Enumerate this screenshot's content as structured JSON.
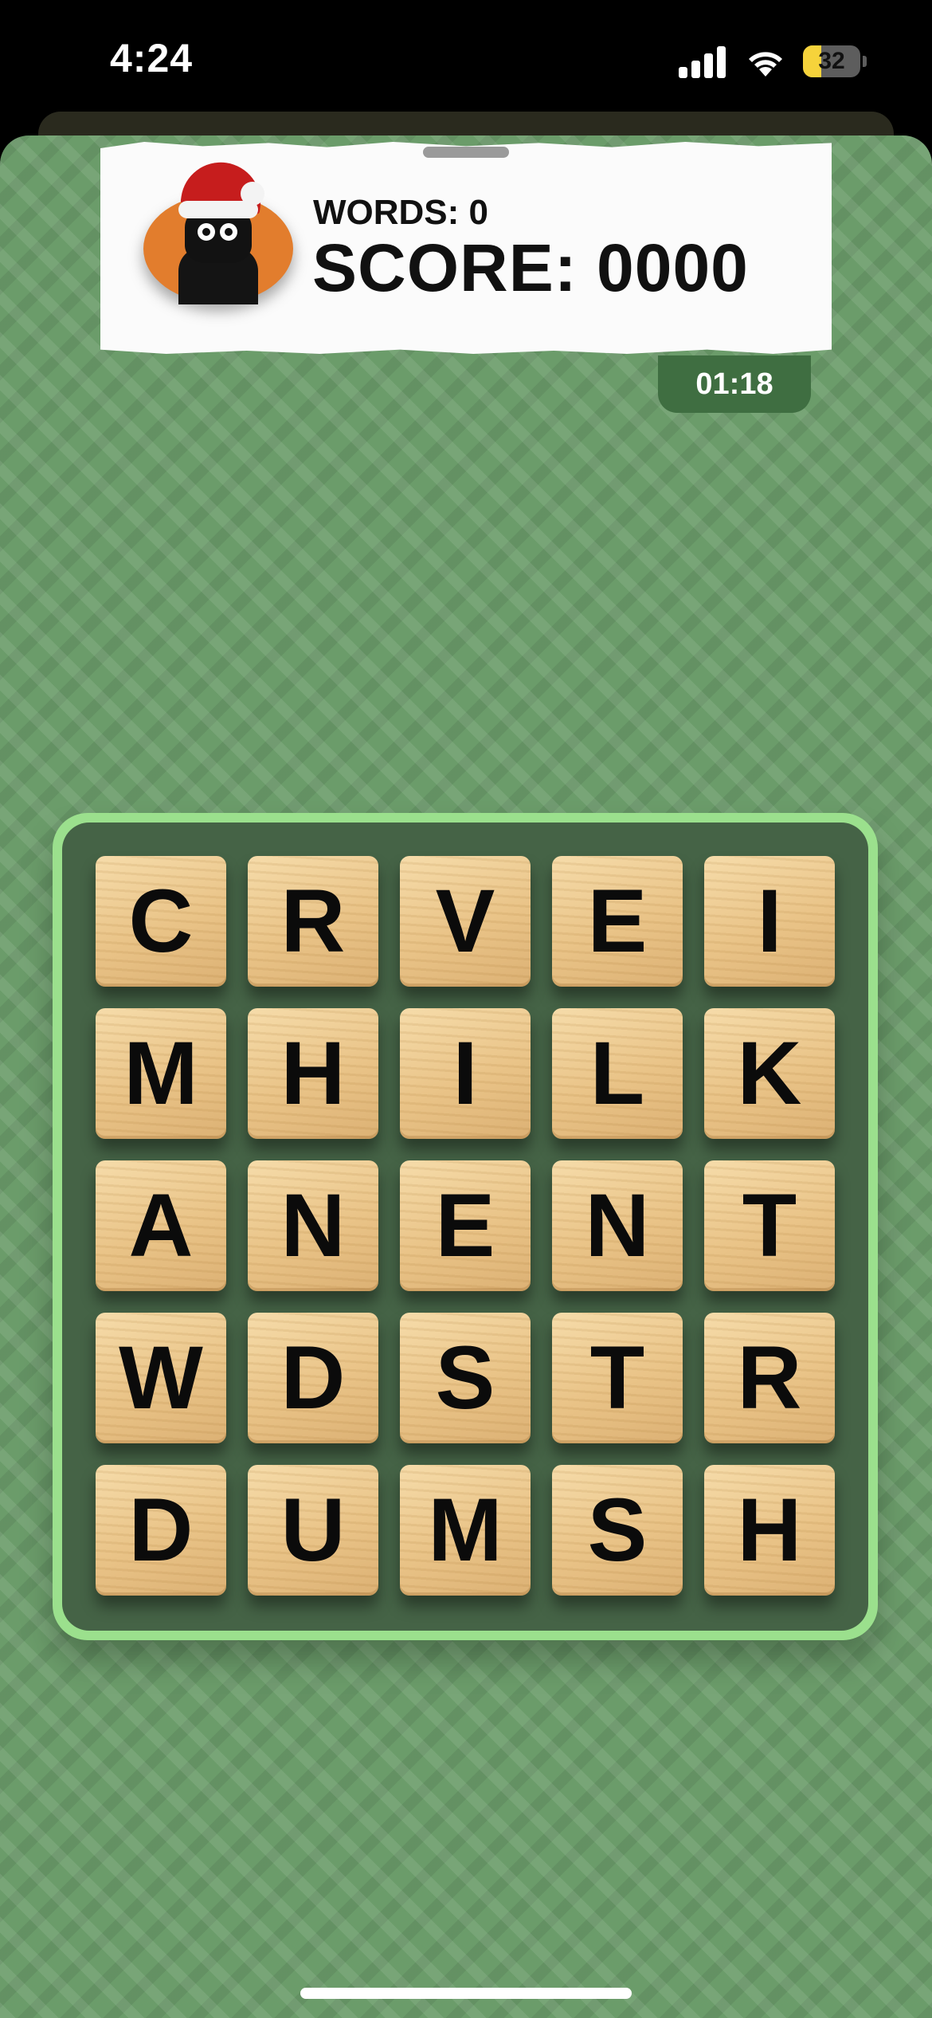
{
  "status_bar": {
    "time": "4:24",
    "battery_level": "32",
    "battery_percent": 32,
    "icons": [
      "cellular-signal-icon",
      "wifi-icon",
      "battery-icon"
    ]
  },
  "header": {
    "words_label": "WORDS: 0",
    "score_label": "SCORE: 0000",
    "avatar": "gorilla-santa-hat-avatar"
  },
  "timer": {
    "value": "01:18"
  },
  "board": {
    "rows": [
      [
        "C",
        "R",
        "V",
        "E",
        "I"
      ],
      [
        "M",
        "H",
        "I",
        "L",
        "K"
      ],
      [
        "A",
        "N",
        "E",
        "N",
        "T"
      ],
      [
        "W",
        "D",
        "S",
        "T",
        "R"
      ],
      [
        "D",
        "U",
        "M",
        "S",
        "H"
      ]
    ]
  },
  "colors": {
    "background": "#6b9c6a",
    "board_border": "#9be08d",
    "board_inner": "#456346",
    "timer": "#3f6e41",
    "avatar": "#e27d2d",
    "battery": "#f6d33b"
  }
}
